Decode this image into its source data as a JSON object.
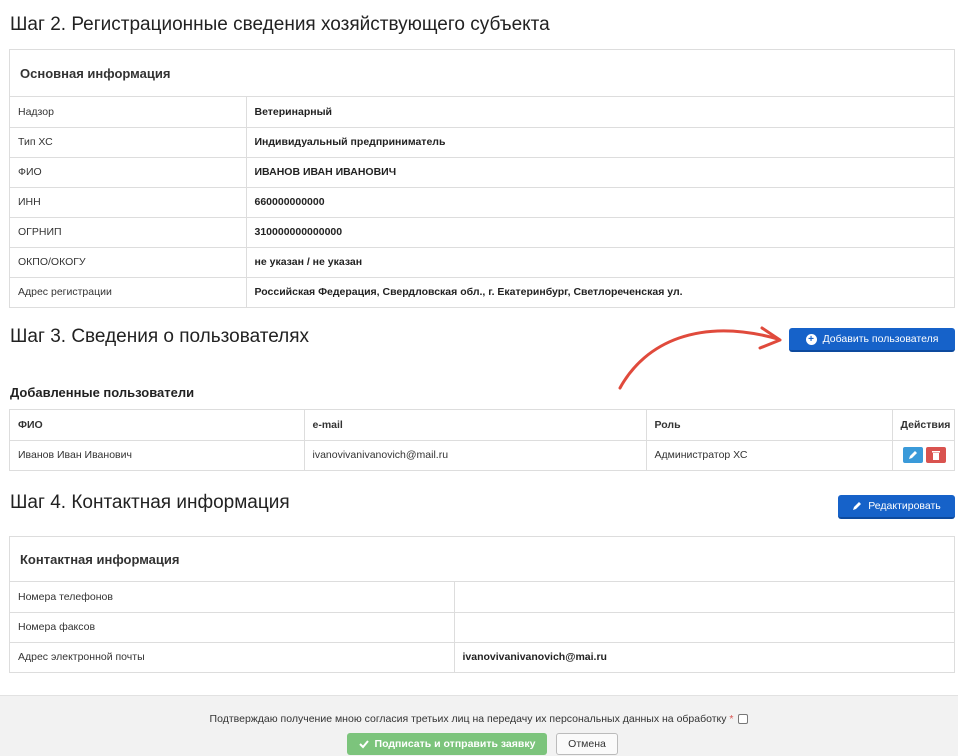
{
  "step2": {
    "title": "Шаг 2. Регистрационные сведения хозяйствующего субъекта",
    "panel_title": "Основная информация",
    "rows": [
      {
        "label": "Надзор",
        "value": "Ветеринарный"
      },
      {
        "label": "Тип ХС",
        "value": "Индивидуальный предприниматель"
      },
      {
        "label": "ФИО",
        "value": "ИВАНОВ ИВАН ИВАНОВИЧ"
      },
      {
        "label": "ИНН",
        "value": "660000000000"
      },
      {
        "label": "ОГРНИП",
        "value": "310000000000000"
      },
      {
        "label": "ОКПО/ОКОГУ",
        "value": "не указан / не указан"
      },
      {
        "label": "Адрес регистрации",
        "value": "Российская Федерация, Свердловская обл., г. Екатеринбург, Светлореченская ул."
      }
    ]
  },
  "step3": {
    "title": "Шаг 3. Сведения о пользователях",
    "add_button": "Добавить пользователя",
    "subtitle": "Добавленные пользователи",
    "columns": [
      "ФИО",
      "e-mail",
      "Роль",
      "Действия"
    ],
    "users": [
      {
        "name": "Иванов Иван Иванович",
        "email": "ivanovivanivanovich@mail.ru",
        "role": "Администратор ХС"
      }
    ]
  },
  "step4": {
    "title": "Шаг 4. Контактная информация",
    "edit_button": "Редактировать",
    "panel_title": "Контактная информация",
    "rows": [
      {
        "label": "Номера телефонов",
        "value": ""
      },
      {
        "label": "Номера факсов",
        "value": ""
      },
      {
        "label": "Адрес электронной почты",
        "value": "ivanovivanivanovich@mai.ru"
      }
    ]
  },
  "footer": {
    "consent_text": "Подтверждаю получение мною согласия третьих лиц на передачу их персональных данных на обработку",
    "required_mark": "*",
    "submit_label": "Подписать и отправить заявку",
    "cancel_label": "Отмена"
  },
  "colors": {
    "primary": "#1662c9",
    "success": "#7cc47c",
    "danger": "#d9534f",
    "info": "#3a9ad9",
    "annotation_arrow": "#e04a3c"
  },
  "icons": {
    "add": "plus-circle-icon",
    "edit": "pencil-icon",
    "delete": "trash-icon",
    "submit": "checkmark-icon"
  }
}
